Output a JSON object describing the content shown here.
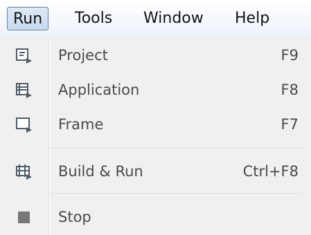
{
  "menubar": {
    "items": [
      {
        "label": "Run",
        "active": true
      },
      {
        "label": "Tools"
      },
      {
        "label": "Window"
      },
      {
        "label": "Help"
      }
    ]
  },
  "run_menu": {
    "items": [
      {
        "label": "Project",
        "shortcut": "F9",
        "icon": "run-project-icon"
      },
      {
        "label": "Application",
        "shortcut": "F8",
        "icon": "run-application-icon"
      },
      {
        "label": "Frame",
        "shortcut": "F7",
        "icon": "run-frame-icon"
      },
      {
        "label": "Build & Run",
        "shortcut": "Ctrl+F8",
        "icon": "build-and-run-icon"
      },
      {
        "label": "Stop",
        "shortcut": "",
        "icon": "stop-icon"
      }
    ]
  },
  "colors": {
    "menubar_active_bg": "#c9d9ef",
    "menubar_active_border": "#6b7f9c",
    "dropdown_bg": "#f0f0f0",
    "icon_color": "#4f5b66",
    "stop_color": "#777777"
  }
}
